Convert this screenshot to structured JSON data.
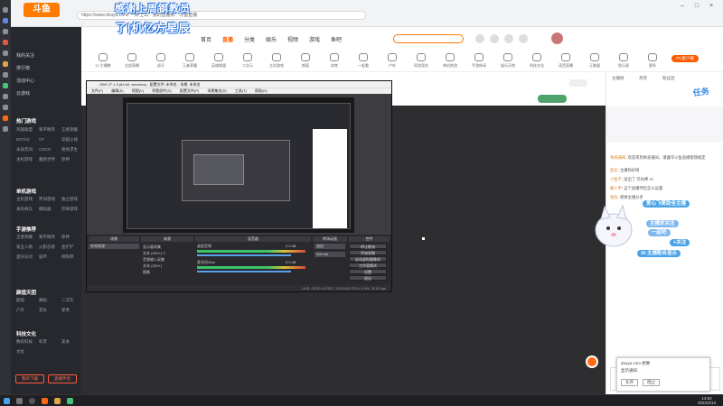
{
  "browser": {
    "url": "https://www.douyu.com/ 一醉上山 · 我的直播间 · 斗鱼直播",
    "tab_title": "斗鱼",
    "banner_top": "感谢上周钢教员",
    "banner_bottom": "了|机亿方星辰"
  },
  "site": {
    "logo": "斗鱼",
    "nav": [
      {
        "label": "首页",
        "active": false
      },
      {
        "label": "直播",
        "active": true
      },
      {
        "label": "分类",
        "active": false
      },
      {
        "label": "娱乐",
        "active": false
      },
      {
        "label": "视频",
        "active": false
      },
      {
        "label": "游戏",
        "active": false
      },
      {
        "label": "鱼吧",
        "active": false
      }
    ],
    "categories": [
      "12 主播数",
      "全部直播",
      "虎牙",
      "王者荣耀",
      "英雄联盟",
      "二次元",
      "主机游戏",
      "颜值",
      "体育",
      "一起看",
      "户外",
      "网游竞技",
      "单机热游",
      "手游休闲",
      "娱乐天地",
      "科技文化",
      "语音直播",
      "正能量",
      "鱼乐星",
      "更多"
    ],
    "pc_button": "PC客户端"
  },
  "sidebar": {
    "top_items": [
      "我的关注",
      "排行榜",
      "活动中心",
      "云游戏"
    ],
    "sections": [
      {
        "title": "热门游戏",
        "items": [
          "英雄联盟",
          "和平精英",
          "王者荣耀",
          "DOTA2",
          "CF",
          "穿越火线",
          "永劫无间",
          "CSGO",
          "绝地求生",
          "主机游戏",
          "魔兽世界",
          "原神"
        ]
      },
      {
        "title": "单机游戏",
        "items": [
          "主机游戏",
          "怀旧游戏",
          "独立游戏",
          "海岛奇兵",
          "模拟器",
          "恐怖游戏"
        ]
      },
      {
        "title": "手游推荐",
        "items": [
          "王者荣耀",
          "和平精英",
          "原神",
          "第五人格",
          "火影忍者",
          "金铲铲",
          "蛋仔派对",
          "崩坏",
          "阴阳师"
        ]
      },
      {
        "title": "颜值天团",
        "items": [
          "颜值",
          "舞蹈",
          "二次元",
          "户外",
          "音乐",
          "星秀"
        ]
      },
      {
        "title": "科技文化",
        "items": [
          "数码科技",
          "科普",
          "美食",
          "文化"
        ]
      }
    ],
    "buttons": [
      "我的下载",
      "直播伴侣"
    ]
  },
  "obs": {
    "title": "OBS 27.1.3 (64-bit, windows) - 配置文件: 未命名 - 场景: 未命名",
    "menu": [
      "文件(F)",
      "编辑(E)",
      "视图(V)",
      "停靠部件(D)",
      "配置文件(P)",
      "场景集合(S)",
      "工具(T)",
      "帮助(H)"
    ],
    "dock_titles": [
      "场景",
      "来源",
      "混音器",
      "转场动画",
      "控件"
    ],
    "sources": [
      "显示器采集",
      "文本 (GDI+) 2",
      "音频输入采集",
      "文本 (GDI+)",
      "图像"
    ],
    "mixer": [
      "桌面音频",
      "麦克风/Aux"
    ],
    "mixer_db": [
      "0.0 dB",
      "0.0 dB"
    ],
    "transition": "淡出",
    "duration": "300 ms",
    "controls": [
      "停止推流",
      "开始录制",
      "启动虚拟摄像机",
      "工作室模式",
      "设置",
      "退出"
    ],
    "status": "LIVE: 00:32:14   REC: 00:00:00   CPU: 4.9%, 30.00 fps",
    "scene_label": "未知来源"
  },
  "chat": {
    "tabs": [
      "主播榜",
      "贵宾",
      "粉丝团"
    ],
    "badge": "任务",
    "lines": [
      {
        "name": "系统通知",
        "text": "欢迎来到本直播间，请遵守斗鱼直播管理规定"
      },
      {
        "name": "鱼友",
        "text": "主播你好呀"
      },
      {
        "name": "小鱼干",
        "text": "送出了 荧光棒 x1"
      },
      {
        "name": "路人甲",
        "text": "这个直播伴侣怎么设置"
      },
      {
        "name": "星辰",
        "text": "感谢主播分享"
      }
    ],
    "bubbles": [
      "爱心飞哥助全主播",
      "主播求关注",
      "一起吧",
      "+关注",
      "AI 主播配合显示"
    ],
    "toast_title": "douyu.com 想要",
    "toast_text": "显示通知",
    "toast_btns": [
      "允许",
      "阻止"
    ]
  },
  "taskbar": {
    "time": "14:52",
    "date": "2022/2/13"
  },
  "colors": {
    "brand": "#ff6a13",
    "obs_bg": "#3c3c41",
    "chat_blue": "#3d8be0"
  }
}
